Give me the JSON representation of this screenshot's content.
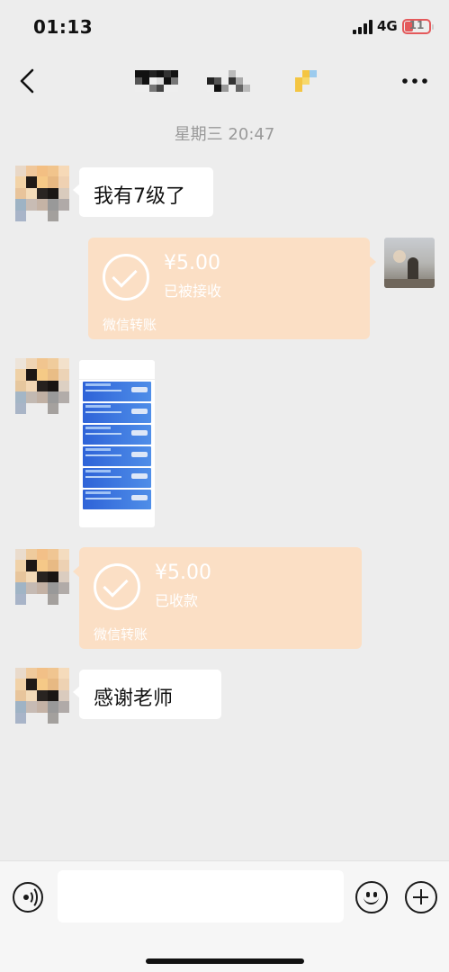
{
  "status_bar": {
    "time": "01:13",
    "network": "4G",
    "battery": "11",
    "battery_color": "#e4595b"
  },
  "nav": {
    "back_icon": "chevron-left-icon",
    "more_icon": "ellipsis-icon"
  },
  "chat": {
    "time_divider": "星期三 20:47",
    "messages": [
      {
        "side": "left",
        "type": "text",
        "text": "我有7级了"
      },
      {
        "side": "right",
        "type": "transfer",
        "amount": "¥5.00",
        "status": "已被接收",
        "label": "微信转账"
      },
      {
        "side": "left",
        "type": "image"
      },
      {
        "side": "left",
        "type": "transfer",
        "amount": "¥5.00",
        "status": "已收款",
        "label": "微信转账"
      },
      {
        "side": "left",
        "type": "text",
        "text": "感谢老师"
      }
    ],
    "transfer_color": "#fbdfc5"
  },
  "input_bar": {
    "voice_icon": "voice-icon",
    "input_value": "",
    "emoji_icon": "emoji-icon",
    "plus_icon": "plus-icon"
  }
}
